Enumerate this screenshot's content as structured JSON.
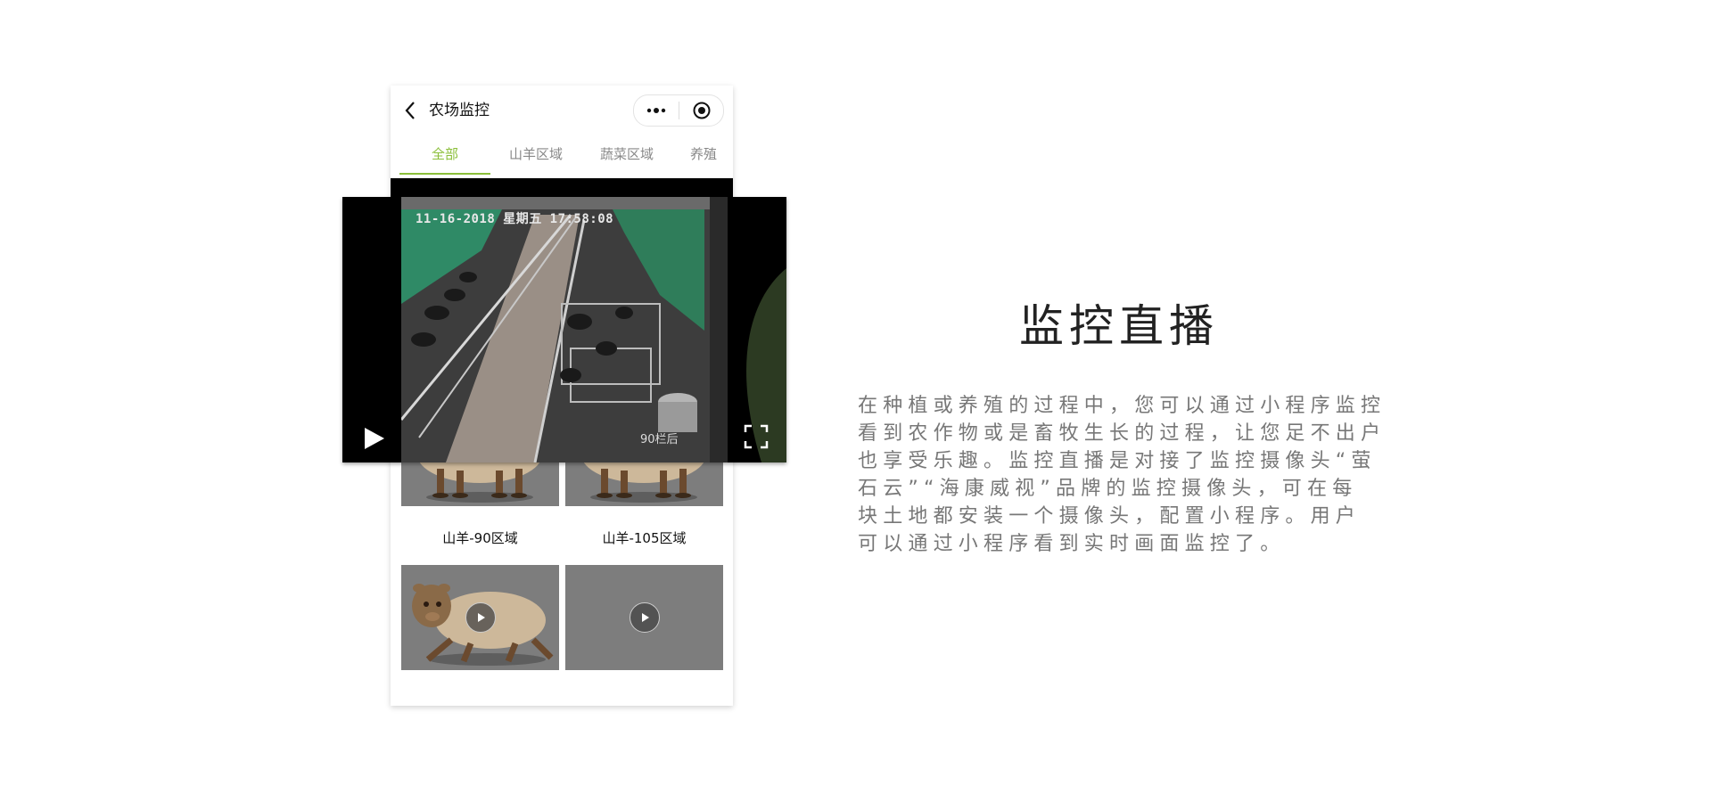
{
  "app": {
    "title": "农场监控",
    "back_icon": "chevron-left-icon",
    "more_icon": "more-dots-icon",
    "close_icon": "target-close-icon"
  },
  "tabs": [
    {
      "label": "全部",
      "active": true
    },
    {
      "label": "山羊区域",
      "active": false
    },
    {
      "label": "蔬菜区域",
      "active": false
    },
    {
      "label": "养殖",
      "active": false
    }
  ],
  "player": {
    "timestamp": "11-16-2018 星期五 17:58:08",
    "overlay_label": "90栏后",
    "play_icon": "play-icon",
    "fullscreen_icon": "fullscreen-icon"
  },
  "grid": [
    {
      "label": "山羊-90区域"
    },
    {
      "label": "山羊-105区域"
    },
    {
      "label": ""
    },
    {
      "label": ""
    }
  ],
  "feature": {
    "heading": "监控直播",
    "lines": [
      "在种植或养殖的过程中，您可以通过小程序监控",
      "看到农作物或是畜牧生长的过程，让您足不出户",
      "也享受乐趣。监控直播是对接了监控摄像头“萤",
      "石云”“海康威视”品牌的监控摄像头，可在每",
      "块土地都安装一个摄像头，配置小程序。用户",
      "可以通过小程序看到实时画面监控了。"
    ]
  },
  "colors": {
    "accent": "#8bbf3a",
    "text_dark": "#111111",
    "text_muted": "#777777"
  }
}
